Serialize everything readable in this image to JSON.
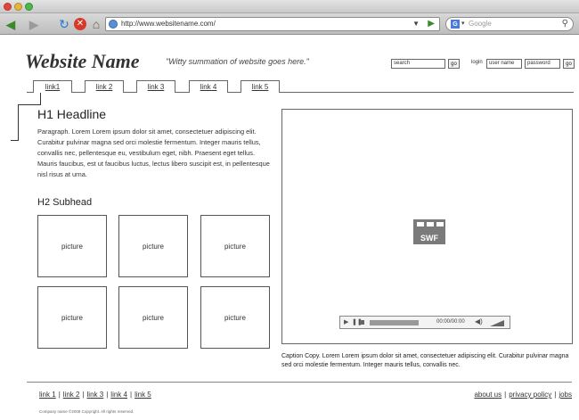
{
  "browser": {
    "url": "http://www.websitename.com/",
    "search_placeholder": "Google",
    "search_engine_icon": "G"
  },
  "header": {
    "logo": "Website Name",
    "tagline": "\"Witty summation of website goes here.\"",
    "search_value": "search",
    "search_button": "go",
    "login_label": "login",
    "username_value": "user name",
    "password_value": "password",
    "login_button": "go"
  },
  "nav": {
    "tabs": [
      "link1",
      "link 2",
      "link 3",
      "link 4",
      "link 5"
    ]
  },
  "main": {
    "headline": "H1 Headline",
    "paragraph": "Paragraph. Lorem Lorem ipsum dolor sit amet, consectetuer adipiscing elit. Curabitur pulvinar magna sed orci molestie fermentum. Integer mauris tellus, convallis nec, pellentesque eu, vestibulum eget, nibh. Praesent eget tellus. Mauris faucibus, est ut faucibus luctus, lectus libero suscipit est, in pellentesque nisl risus at urna.",
    "subhead": "H2 Subhead",
    "pictures": [
      "picture",
      "picture",
      "picture",
      "picture",
      "picture",
      "picture"
    ]
  },
  "media": {
    "swf_label": "SWF",
    "time": "00:00/00:00",
    "caption": "Caption Copy. Lorem Lorem ipsum dolor sit amet, consectetuer adipiscing elit. Curabitur pulvinar magna sed orci molestie fermentum. Integer mauris tellus, convallis nec."
  },
  "footer": {
    "links": [
      "link 1",
      "link 2",
      "link 3",
      "link 4",
      "link 5"
    ],
    "right_links": [
      "about us",
      "privacy policy",
      "jobs"
    ],
    "copyright": "Company name ©2008 Copyright. All rights reserved."
  }
}
